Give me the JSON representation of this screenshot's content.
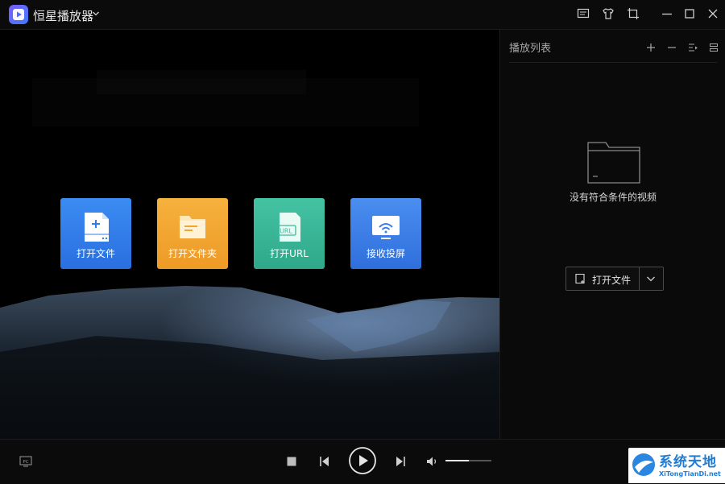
{
  "app": {
    "title": "恒星播放器",
    "logo_icon": "play-logo-icon"
  },
  "titlebar_buttons": [
    {
      "name": "feedback-icon"
    },
    {
      "name": "skin-icon"
    },
    {
      "name": "mini-mode-icon"
    },
    {
      "name": "minimize-icon"
    },
    {
      "name": "maximize-icon"
    },
    {
      "name": "close-icon"
    }
  ],
  "tiles": [
    {
      "label": "打开文件",
      "color": "#2f7fe8",
      "icon": "open-file-icon"
    },
    {
      "label": "打开文件夹",
      "color": "#f2a531",
      "icon": "open-folder-icon"
    },
    {
      "label": "打开URL",
      "color": "#3db89a",
      "icon": "open-url-icon",
      "icon_text": "URL"
    },
    {
      "label": "接收投屏",
      "color": "#3d7ee8",
      "icon": "screen-cast-icon"
    }
  ],
  "playlist": {
    "title": "播放列表",
    "empty_text": "没有符合条件的视频",
    "open_file_label": "打开文件",
    "buttons": [
      "add-icon",
      "remove-icon",
      "play-mode-icon",
      "list-menu-icon"
    ]
  },
  "controls": {
    "pc_icon_text": "PC",
    "volume_percent": 50
  },
  "watermark": {
    "main": "系统天地",
    "sub": "XiTongTianDi.net"
  },
  "colors": {
    "accent": "#3e7bff",
    "tile_blue": "#2f7fe8",
    "tile_orange": "#f2a531",
    "tile_green": "#3db89a"
  }
}
